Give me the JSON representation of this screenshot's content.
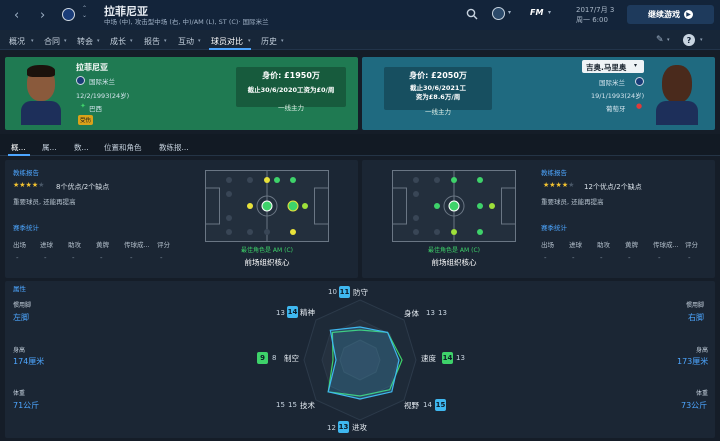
{
  "header": {
    "title": "拉菲尼亚",
    "subtitle": "中场 (中), 攻击型中场 (右, 中)/AM (L), ST (C)· 国际米兰",
    "date": "2017/7月 3",
    "weekday": "周一 6:00",
    "continue_label": "继续游戏",
    "fm_label": "FM"
  },
  "menu": [
    "概况",
    "合同",
    "转会",
    "成长",
    "报告",
    "互动",
    "球员对比",
    "历史"
  ],
  "player_left": {
    "name": "拉菲尼亚",
    "club": "国际米兰",
    "dob": "12/2/1993(24岁)",
    "nation": "巴西",
    "badge": "受伤",
    "value": "身价: £1950万",
    "contract": "截止30/6/2020工资为£0/周",
    "role": "一线主力"
  },
  "player_right": {
    "name": "吉奥.马里奥",
    "club": "国际米兰",
    "dob": "19/1/1993(24岁)",
    "nation": "葡萄牙",
    "value": "身价: £2050万",
    "contract_line1": "截止30/6/2021工",
    "contract_line2": "资为£8.6万/周",
    "role": "一线主力"
  },
  "tabs": [
    "概...",
    "属...",
    "数...",
    "位置和角色",
    "教练报..."
  ],
  "panel_left": {
    "report_label": "教练报告",
    "stars_text": "8个优点/2个缺点",
    "stars_filled": 3.5,
    "report_desc": "重要球员, 还能再提高",
    "stats_label": "赛季统计",
    "stat_headers": [
      "出场",
      "进球",
      "助攻",
      "黄牌",
      "传球成...",
      "评分"
    ],
    "stat_values": [
      "-",
      "-",
      "-",
      "-",
      "-",
      "-"
    ],
    "best_role_label": "最佳角色是 AM (C)",
    "role_name": "前场组织核心"
  },
  "panel_right": {
    "report_label": "教练报告",
    "stars_text": "12个优点/2个缺点",
    "stars_filled": 3.5,
    "report_desc": "重要球员, 还能再提高",
    "stats_label": "赛季统计",
    "stat_headers": [
      "出场",
      "进球",
      "助攻",
      "黄牌",
      "传球成...",
      "评分"
    ],
    "stat_values": [
      "-",
      "-",
      "-",
      "-",
      "-",
      "-"
    ],
    "best_role_label": "最佳角色是 AM (C)",
    "role_name": "前场组织核心"
  },
  "attributes": {
    "section_label": "属性",
    "items": [
      {
        "name": "防守",
        "left": "10",
        "right": "11"
      },
      {
        "name": "身体",
        "left": "13",
        "right": "13"
      },
      {
        "name": "速度",
        "left": "14",
        "right": "13"
      },
      {
        "name": "视野",
        "left": "14",
        "right": "15"
      },
      {
        "name": "进攻",
        "left": "12",
        "right": "13"
      },
      {
        "name": "技术",
        "left": "15",
        "right": "15"
      },
      {
        "name": "制空",
        "left": "9",
        "right": "8"
      },
      {
        "name": "精神",
        "left": "13",
        "right": "14"
      }
    ],
    "left_side": {
      "foot_label": "惯用脚",
      "foot": "左脚",
      "height_label": "身高",
      "height": "174厘米",
      "weight_label": "体重",
      "weight": "71公斤"
    },
    "right_side": {
      "foot_label": "惯用脚",
      "foot": "右脚",
      "height_label": "身高",
      "height": "173厘米",
      "weight_label": "体重",
      "weight": "73公斤"
    }
  },
  "colors": {
    "left_card": "#1f7a52",
    "right_card": "#1f6a80",
    "accent": "#4da6ff",
    "left_attr": "#3ed26a",
    "right_attr": "#3fb7ef"
  }
}
